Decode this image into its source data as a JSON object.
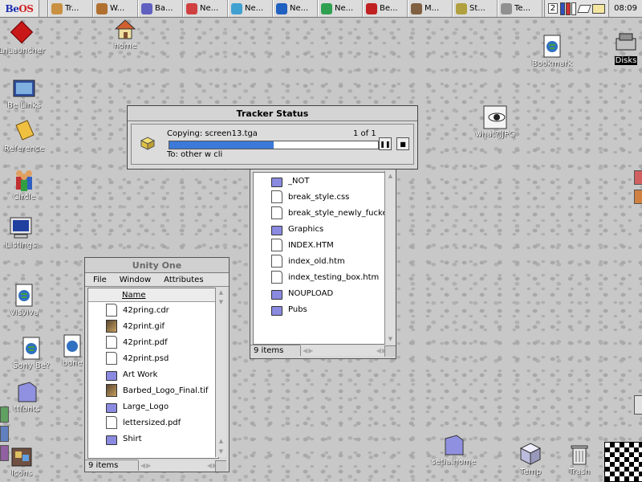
{
  "deskbar": {
    "logo_be": "Be",
    "logo_os": "OS",
    "tasks": [
      "Tr...",
      "W...",
      "Ba...",
      "Ne...",
      "Ne...",
      "Ne...",
      "Ne...",
      "Be...",
      "M...",
      "St...",
      "Te..."
    ],
    "task_colors": [
      "#c89040",
      "#b07030",
      "#6060c0",
      "#d04040",
      "#40a0d0",
      "#2060c0",
      "#30a050",
      "#c02020",
      "#806040",
      "#b0a040",
      "#909090"
    ],
    "workspace": "2",
    "clock": "08:09"
  },
  "desktop_icons": [
    {
      "label": "LnLauncher",
      "icon": "red-diamond-icon"
    },
    {
      "label": "home",
      "icon": "home-icon"
    },
    {
      "label": "Be Links",
      "icon": "folder-links-icon"
    },
    {
      "label": "Reference",
      "icon": "book-icon"
    },
    {
      "label": "Circle",
      "icon": "people-icon"
    },
    {
      "label": "Listings",
      "icon": "monitor-icon"
    },
    {
      "label": "Visviva",
      "icon": "globe-document-icon"
    },
    {
      "label": "Sony Be?",
      "icon": "globe-document-icon"
    },
    {
      "label": "bone",
      "icon": "globe-document-icon"
    },
    {
      "label": "ttfonts",
      "icon": "folder-icon"
    },
    {
      "label": "Icons",
      "icon": "icons-folder-icon"
    },
    {
      "label": "Bookmark",
      "icon": "globe-document-icon"
    },
    {
      "label": "Disks",
      "icon": "disks-icon"
    },
    {
      "label": "what?.JPG",
      "icon": "image-eye-icon"
    },
    {
      "label": "setia.home",
      "icon": "folder-icon"
    },
    {
      "label": "Temp",
      "icon": "temp-icon"
    },
    {
      "label": "Trash",
      "icon": "trash-icon"
    }
  ],
  "tracker": {
    "title": "Tracker Status",
    "copying": "Copying: screen13.tga",
    "count": "1 of 1",
    "to": "To: other w cli",
    "progress": 0.5
  },
  "unity_window": {
    "title": "Unity One",
    "menu": [
      "File",
      "Window",
      "Attributes"
    ],
    "column": "Name",
    "items": [
      {
        "name": "42pring.cdr",
        "type": "doc"
      },
      {
        "name": "42print.gif",
        "type": "img"
      },
      {
        "name": "42print.pdf",
        "type": "doc"
      },
      {
        "name": "42print.psd",
        "type": "doc"
      },
      {
        "name": "Art Work",
        "type": "folder"
      },
      {
        "name": "Barbed_Logo_Final.tif",
        "type": "img"
      },
      {
        "name": "Large_Logo",
        "type": "folder"
      },
      {
        "name": "lettersized.pdf",
        "type": "doc"
      },
      {
        "name": "Shirt",
        "type": "folder"
      }
    ],
    "status": "9 items"
  },
  "back_window": {
    "items": [
      {
        "name": "_NOT",
        "type": "folder"
      },
      {
        "name": "break_style.css",
        "type": "doc"
      },
      {
        "name": "break_style_newly_fucke",
        "type": "doc"
      },
      {
        "name": "Graphics",
        "type": "folder"
      },
      {
        "name": "INDEX.HTM",
        "type": "doc"
      },
      {
        "name": "index_old.htm",
        "type": "doc"
      },
      {
        "name": "index_testing_box.htm",
        "type": "doc"
      },
      {
        "name": "NOUPLOAD",
        "type": "folder"
      },
      {
        "name": "Pubs",
        "type": "folder"
      }
    ],
    "status": "9 items"
  }
}
